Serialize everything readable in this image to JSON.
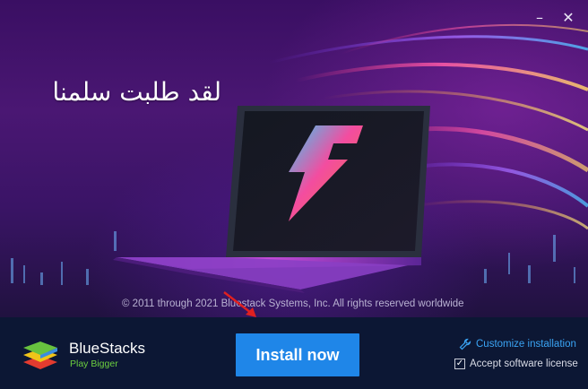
{
  "window": {
    "minimize_icon": "minimize-icon",
    "close_icon": "close-icon",
    "minimize_glyph": "–",
    "close_glyph": "✕"
  },
  "hero": {
    "arabic_text": "لقد طلبت سلمنا",
    "copyright": "© 2011 through 2021 Bluestack Systems, Inc. All rights reserved worldwide"
  },
  "footer": {
    "brand_name": "BlueStacks",
    "tagline": "Play Bigger",
    "install_button": "Install now",
    "customize_link": "Customize installation",
    "accept_label": "Accept software license",
    "accept_checked": true,
    "check_glyph": "✓"
  },
  "colors": {
    "accent": "#1f86e8",
    "link": "#3aa4f5",
    "tagline": "#6ccf3f",
    "footer_bg": "#0c1734",
    "hero_bg": "#3a0f63"
  }
}
